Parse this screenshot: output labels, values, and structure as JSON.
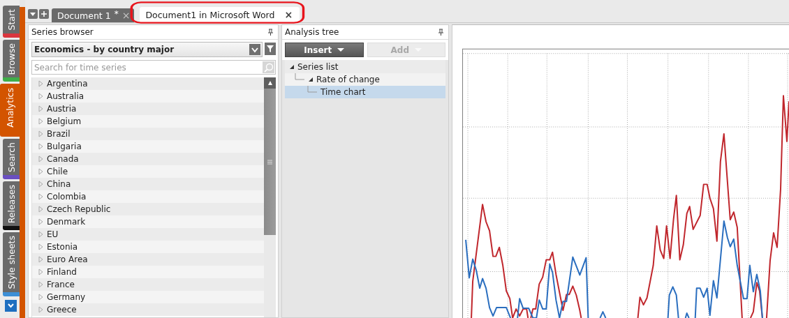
{
  "side_tabs": [
    {
      "label": "Start",
      "color": "#d9363e",
      "selected": false
    },
    {
      "label": "Browse",
      "color": "#3fae49",
      "selected": false
    },
    {
      "label": "Analytics",
      "color": "#d35400",
      "selected": true
    },
    {
      "label": "Search",
      "color": "#6a4fc0",
      "selected": false
    },
    {
      "label": "Releases",
      "color": "#111111",
      "selected": false
    },
    {
      "label": "Style sheets",
      "color": "#3d8fd6",
      "selected": false
    }
  ],
  "document_tabs": [
    {
      "label": "Document 1",
      "modified_mark": "*",
      "close": "×",
      "selected": false
    },
    {
      "label": "Document1 in Microsoft Word",
      "close": "×",
      "selected": true
    }
  ],
  "series_browser": {
    "title": "Series browser",
    "database": "Economics - by country major",
    "search": {
      "placeholder": "Search for time series"
    },
    "items": [
      "Argentina",
      "Australia",
      "Austria",
      "Belgium",
      "Brazil",
      "Bulgaria",
      "Canada",
      "Chile",
      "China",
      "Colombia",
      "Czech Republic",
      "Denmark",
      "EU",
      "Estonia",
      "Euro Area",
      "Finland",
      "France",
      "Germany",
      "Greece"
    ]
  },
  "analysis_tree": {
    "title": "Analysis tree",
    "buttons": [
      {
        "label": "Insert",
        "disabled": false
      },
      {
        "label": "Add",
        "disabled": true
      }
    ],
    "tree": [
      {
        "label": "Series list",
        "expanded": true,
        "selected": false,
        "children": [
          {
            "label": "Rate of change",
            "expanded": true,
            "selected": false,
            "children": [
              {
                "label": "Time chart",
                "selected": true
              }
            ]
          }
        ]
      }
    ]
  }
}
